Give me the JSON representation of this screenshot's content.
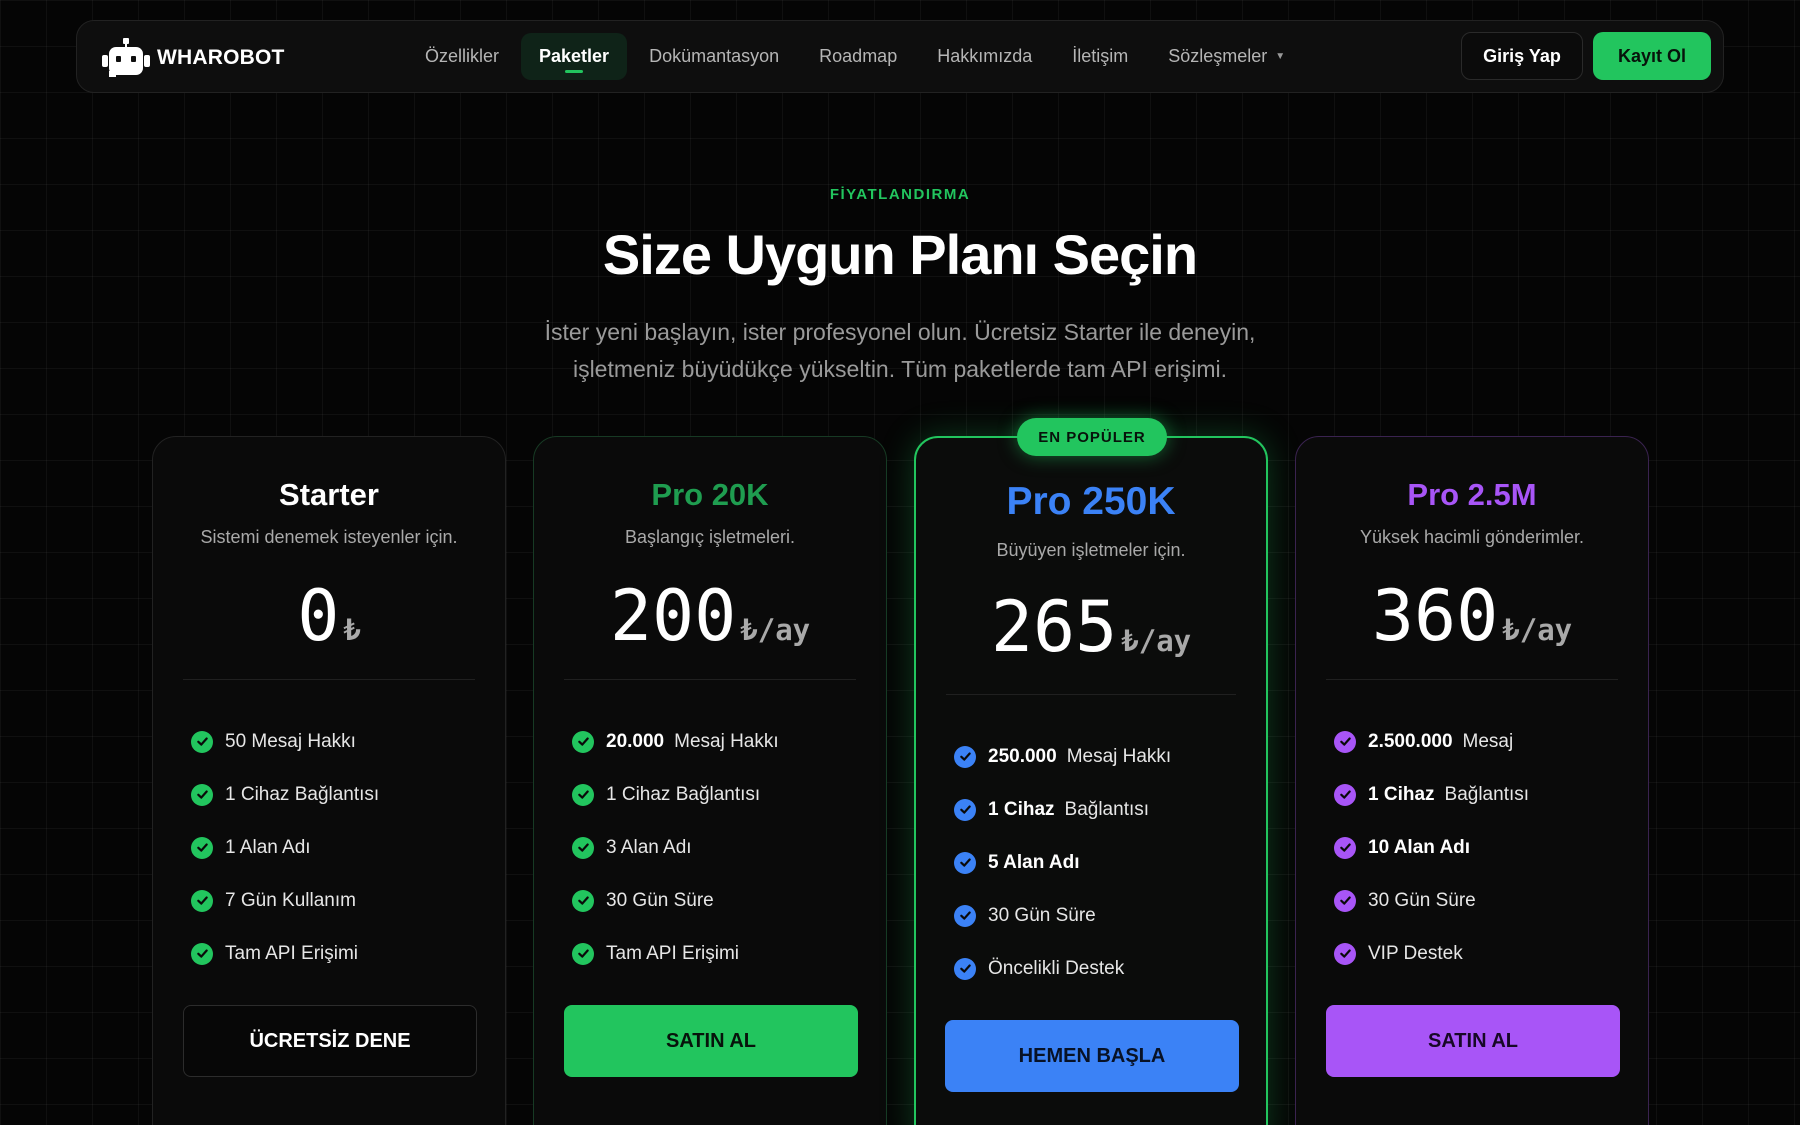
{
  "brand": {
    "name": "WHAROBOT"
  },
  "nav": {
    "items": [
      {
        "label": "Özellikler"
      },
      {
        "label": "Paketler"
      },
      {
        "label": "Dokümantasyon"
      },
      {
        "label": "Roadmap"
      },
      {
        "label": "Hakkımızda"
      },
      {
        "label": "İletişim"
      },
      {
        "label": "Sözleşmeler"
      }
    ],
    "active": "Paketler",
    "login_label": "Giriş Yap",
    "signup_label": "Kayıt Ol"
  },
  "hero": {
    "eyebrow": "FİYATLANDIRMA",
    "title": "Size Uygun Planı Seçin",
    "subtitle_line1": "İster yeni başlayın, ister profesyonel olun. Ücretsiz Starter ile deneyin,",
    "subtitle_line2": "işletmeniz büyüdükçe yükseltin. Tüm paketlerde tam API erişimi."
  },
  "colors": {
    "green": "#22c55e",
    "blue": "#3b82f6",
    "purple": "#a855f7",
    "dark_green_title": "#1f9d50"
  },
  "plans": [
    {
      "name": "Starter",
      "desc": "Sistemi denemek isteyenler için.",
      "price": "0",
      "unit": "₺",
      "features": [
        {
          "bold": "",
          "text": "50 Mesaj Hakkı"
        },
        {
          "bold": "",
          "text": "1 Cihaz Bağlantısı"
        },
        {
          "bold": "",
          "text": "1 Alan Adı"
        },
        {
          "bold": "",
          "text": "7 Gün Kullanım"
        },
        {
          "bold": "",
          "text": "Tam API Erişimi"
        }
      ],
      "cta": "ÜCRETSİZ DENE"
    },
    {
      "name": "Pro 20K",
      "desc": "Başlangıç işletmeleri.",
      "price": "200",
      "unit": "₺/ay",
      "features": [
        {
          "bold": "20.000",
          "text": "Mesaj Hakkı"
        },
        {
          "bold": "",
          "text": "1 Cihaz Bağlantısı"
        },
        {
          "bold": "",
          "text": "3 Alan Adı"
        },
        {
          "bold": "",
          "text": "30 Gün Süre"
        },
        {
          "bold": "",
          "text": "Tam API Erişimi"
        }
      ],
      "cta": "SATIN AL"
    },
    {
      "badge": "EN POPÜLER",
      "name": "Pro 250K",
      "desc": "Büyüyen işletmeler için.",
      "price": "265",
      "unit": "₺/ay",
      "features": [
        {
          "bold": "250.000",
          "text": "Mesaj Hakkı"
        },
        {
          "bold": "1 Cihaz",
          "text": "Bağlantısı"
        },
        {
          "bold": "5 Alan Adı",
          "text": ""
        },
        {
          "bold": "",
          "text": "30 Gün Süre"
        },
        {
          "bold": "",
          "text": "Öncelikli Destek"
        }
      ],
      "cta": "HEMEN BAŞLA"
    },
    {
      "name": "Pro 2.5M",
      "desc": "Yüksek hacimli gönderimler.",
      "price": "360",
      "unit": "₺/ay",
      "features": [
        {
          "bold": "2.500.000",
          "text": "Mesaj"
        },
        {
          "bold": "1 Cihaz",
          "text": "Bağlantısı"
        },
        {
          "bold": "10 Alan Adı",
          "text": ""
        },
        {
          "bold": "",
          "text": "30 Gün Süre"
        },
        {
          "bold": "",
          "text": "VIP Destek"
        }
      ],
      "cta": "SATIN AL"
    }
  ]
}
